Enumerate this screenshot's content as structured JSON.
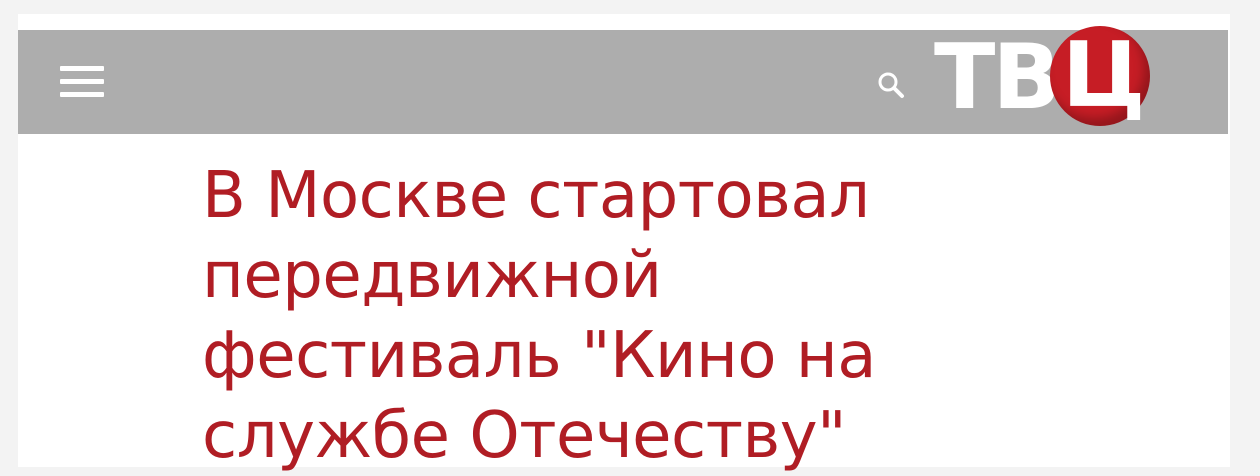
{
  "header": {
    "menu_icon": "hamburger-menu-icon",
    "search_icon": "magnifier-icon",
    "logo": {
      "letters_white": "ТВ",
      "letter_circle": "Ц",
      "circle_color": "#c61d25"
    },
    "bar_color": "#adadad"
  },
  "article": {
    "headline": "В Москве стартовал\nпередвижной\nфестиваль \"Кино на\nслужбе Отечеству\"",
    "headline_color": "#b01d24"
  }
}
